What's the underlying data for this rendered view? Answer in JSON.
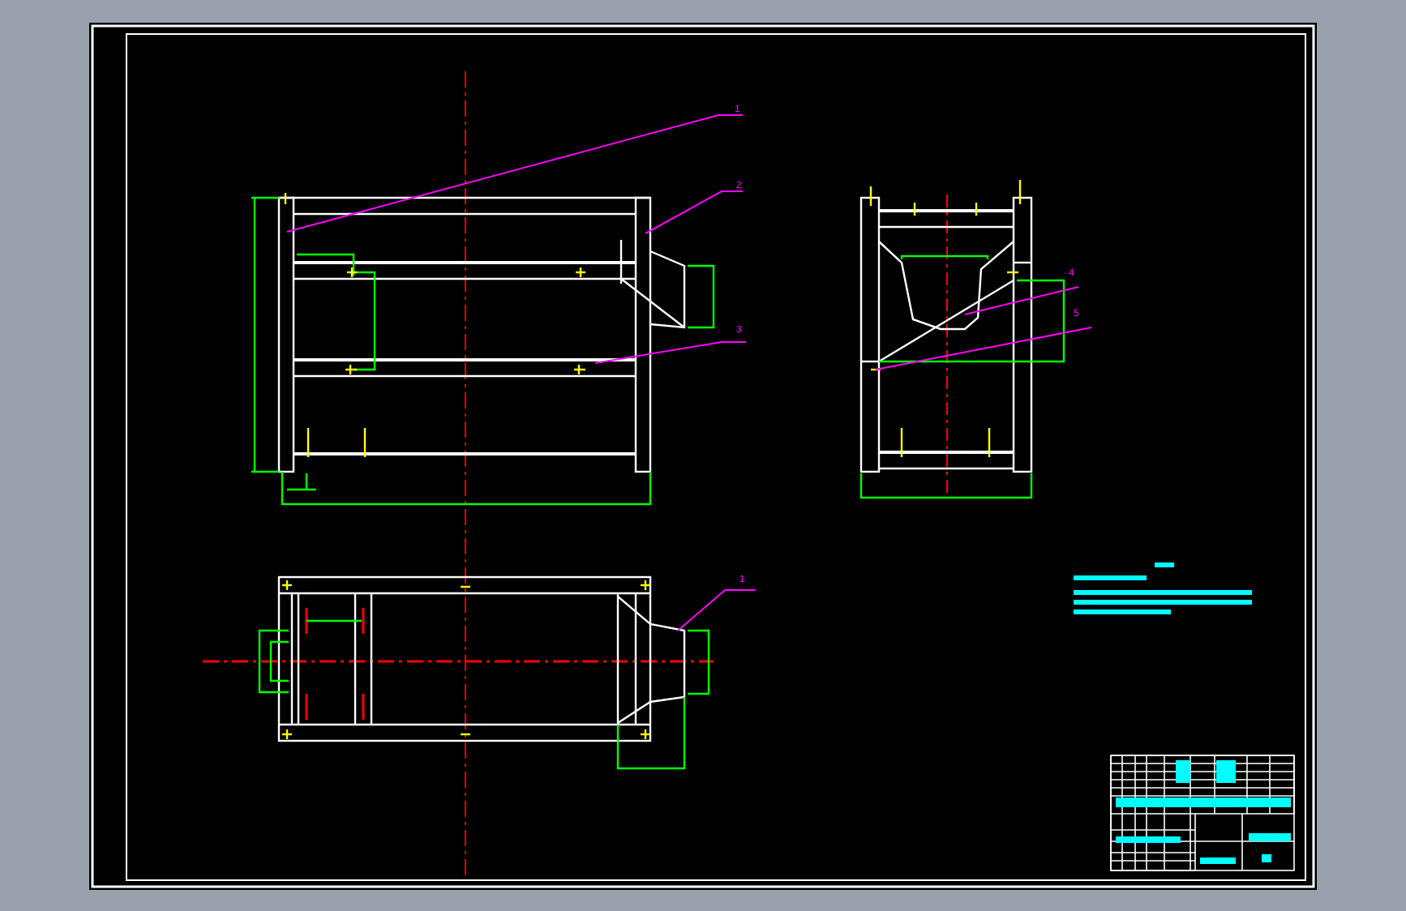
{
  "front_view": {
    "balloons": [
      {
        "label": "1"
      },
      {
        "label": "2"
      },
      {
        "label": "3"
      }
    ]
  },
  "side_view": {
    "balloons": [
      {
        "label": "4"
      },
      {
        "label": "5"
      }
    ]
  },
  "plan_view": {
    "balloons": [
      {
        "label": "1"
      }
    ]
  }
}
